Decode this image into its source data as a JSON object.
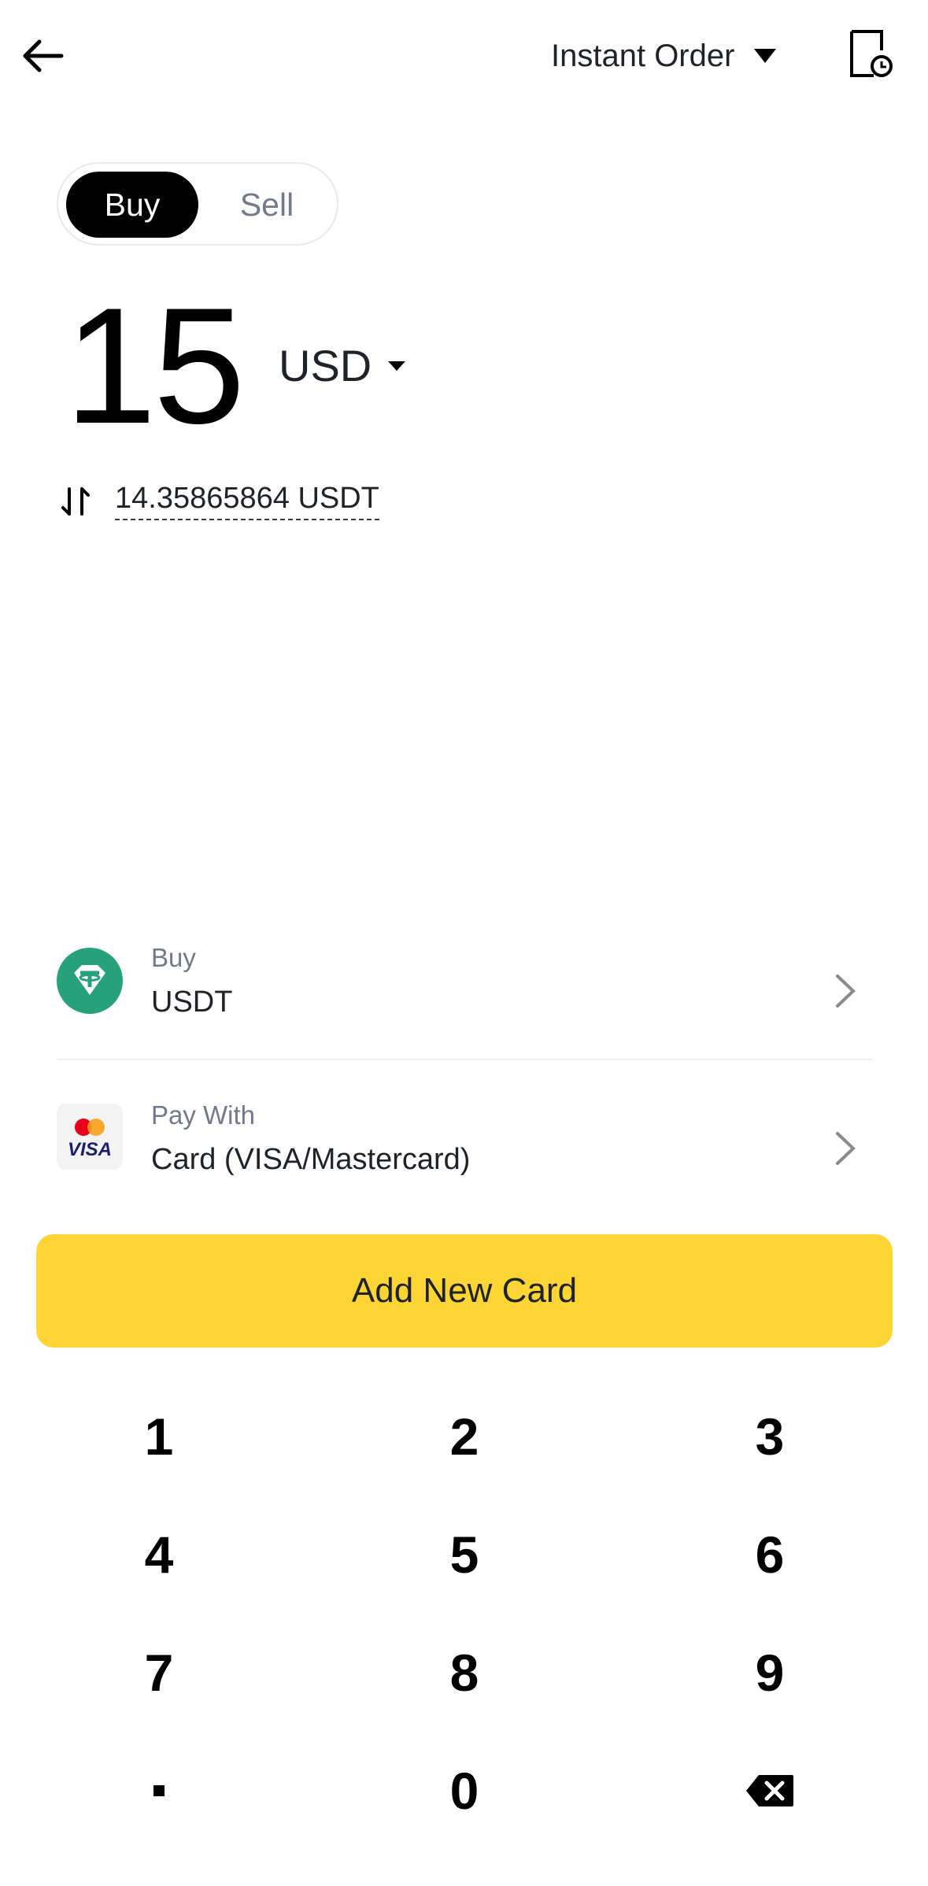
{
  "header": {
    "order_type": "Instant Order"
  },
  "trade_toggle": {
    "buy": "Buy",
    "sell": "Sell",
    "selected": "Buy"
  },
  "amount": {
    "value": "15",
    "currency": "USD"
  },
  "conversion": {
    "value": "14.35865864 USDT"
  },
  "buy_row": {
    "label": "Buy",
    "value": "USDT"
  },
  "pay_row": {
    "label": "Pay With",
    "value": "Card (VISA/Mastercard)",
    "card_text": "VISA"
  },
  "cta": {
    "label": "Add New Card",
    "color": "#FCD535"
  },
  "keypad": {
    "keys": [
      "1",
      "2",
      "3",
      "4",
      "5",
      "6",
      "7",
      "8",
      "9",
      ".",
      "0"
    ]
  },
  "colors": {
    "accent": "#FCD535",
    "tether": "#26A17B",
    "text": "#1E2329",
    "muted": "#707A8A"
  }
}
